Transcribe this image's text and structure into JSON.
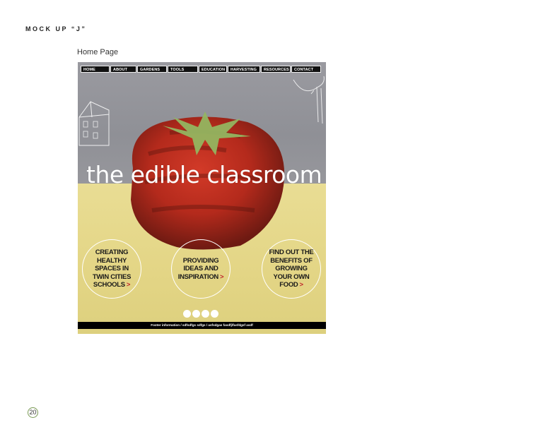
{
  "document": {
    "mockup_title": "MOCK UP “J”",
    "page_label": "Home Page",
    "page_number": "20"
  },
  "site": {
    "nav": [
      "HOME",
      "ABOUT",
      "GARDENS",
      "TOOLS",
      "EDUCATION",
      "HARVESTING",
      "RESOURCES",
      "CONTACT"
    ],
    "hero_title": "the edible classroom",
    "features": [
      {
        "text": "CREATING HEALTHY SPACES IN TWIN CITIES SCHOOLS",
        "arrow": ">"
      },
      {
        "text": "PROVIDING IDEAS AND INSPIRATION",
        "arrow": ">"
      },
      {
        "text": "FIND OUT THE BENEFITS OF GROWING YOUR OWN FOOD",
        "arrow": ">"
      }
    ],
    "slide_dots": 4,
    "footer": "Footer information / sdfsdfgs sdfgs / asfsdgas fasdfj/fasfdgsf asdf"
  },
  "colors": {
    "sky": "#9a9aa0",
    "ground": "#e6d98a",
    "tomato": "#b5291c",
    "stem": "#8fb05a",
    "arrow": "#c0262b"
  }
}
